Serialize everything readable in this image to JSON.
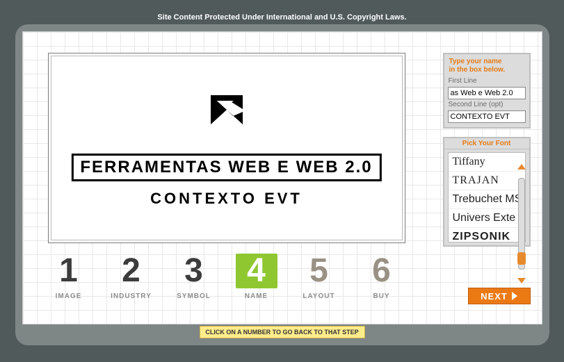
{
  "copyright": "Site Content Protected Under International and U.S. Copyright Laws.",
  "preview": {
    "line1": "FERRAMENTAS WEB E WEB 2.0",
    "line2": "CONTEXTO EVT"
  },
  "panel": {
    "title_l1": "Type your name",
    "title_l2": "in the box below.",
    "label_first": "First Line",
    "label_second": "Second Line (opt)",
    "value_first": "as Web e Web 2.0",
    "value_second": "CONTEXTO EVT",
    "pick_font": "Pick Your Font",
    "fonts": {
      "f0": "Tiffany",
      "f1": "TRAJAN",
      "f2": "Trebuchet MS",
      "f3": "Univers Exte",
      "f4": "ZIPSONIK"
    }
  },
  "steps": {
    "s1": {
      "num": "1",
      "label": "IMAGE"
    },
    "s2": {
      "num": "2",
      "label": "INDUSTRY"
    },
    "s3": {
      "num": "3",
      "label": "SYMBOL"
    },
    "s4": {
      "num": "4",
      "label": "NAME"
    },
    "s5": {
      "num": "5",
      "label": "LAYOUT"
    },
    "s6": {
      "num": "6",
      "label": "BUY"
    }
  },
  "next": "NEXT",
  "hint": "CLICK ON A NUMBER TO GO BACK TO THAT STEP"
}
